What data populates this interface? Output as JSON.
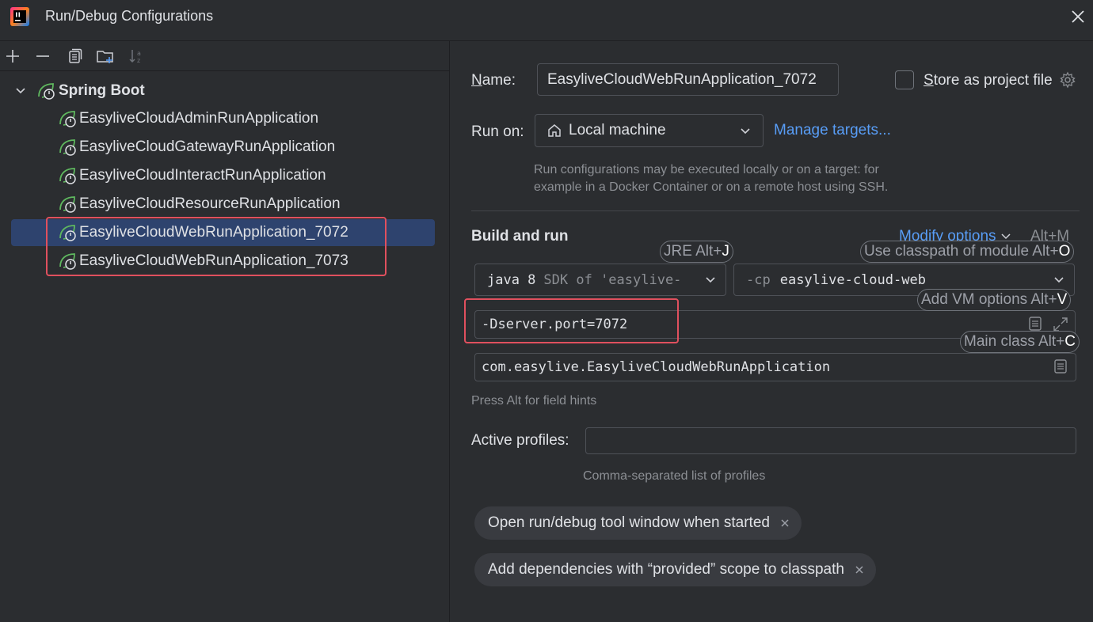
{
  "window": {
    "title": "Run/Debug Configurations"
  },
  "toolbar": {
    "buttons": [
      "plus-icon",
      "minus-icon",
      "copy-icon",
      "new-folder-icon",
      "sort-icon"
    ]
  },
  "tree": {
    "group_label": "Spring Boot",
    "items": [
      {
        "label": "EasyliveCloudAdminRunApplication",
        "selected": false
      },
      {
        "label": "EasyliveCloudGatewayRunApplication",
        "selected": false
      },
      {
        "label": "EasyliveCloudInteractRunApplication",
        "selected": false
      },
      {
        "label": "EasyliveCloudResourceRunApplication",
        "selected": false
      },
      {
        "label": "EasyliveCloudWebRunApplication_7072",
        "selected": true
      },
      {
        "label": "EasyliveCloudWebRunApplication_7073",
        "selected": false
      }
    ]
  },
  "form": {
    "name_label": "Name:",
    "name_value": "EasyliveCloudWebRunApplication_7072",
    "store_label": "Store as project file",
    "run_on_label": "Run on:",
    "run_on_value": "Local machine",
    "manage_targets": "Manage targets...",
    "run_on_hint_1": "Run configurations may be executed locally or on a target: for",
    "run_on_hint_2": "example in a Docker Container or on a remote host using SSH.",
    "build_run_title": "Build and run",
    "modify_options": "Modify options",
    "modify_shortcut": "Alt+M",
    "jre_value_1": "java 8",
    "jre_value_2": "SDK of 'easylive-",
    "cp_prefix": "-cp",
    "cp_value": "easylive-cloud-web",
    "vm_options": "-Dserver.port=7072",
    "main_class": "com.easylive.EasyliveCloudWebRunApplication",
    "field_hint": "Press Alt for field hints",
    "active_profiles_label": "Active profiles:",
    "active_profiles_value": "",
    "active_profiles_hint": "Comma-separated list of profiles"
  },
  "tips": {
    "jre": {
      "text": "JRE Alt+",
      "key": "J"
    },
    "classpath": {
      "text": "Use classpath of module Alt+",
      "key": "O"
    },
    "vm": {
      "text": "Add VM options Alt+",
      "key": "V"
    },
    "main": {
      "text": "Main class Alt+",
      "key": "C"
    }
  },
  "chips": [
    {
      "label": "Open run/debug tool window when started"
    },
    {
      "label": "Add dependencies with “provided” scope to classpath"
    }
  ],
  "colors": {
    "background": "#2b2d30",
    "selection": "#2e436e",
    "accent_link": "#589df6",
    "highlight_box": "#e0505e",
    "spring_green": "#5fb85f"
  }
}
